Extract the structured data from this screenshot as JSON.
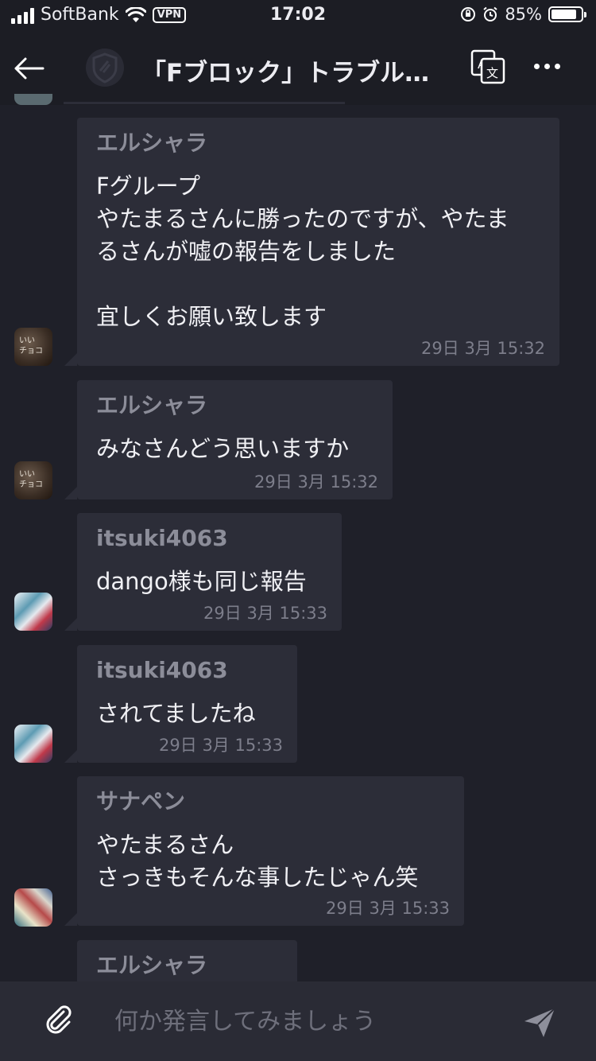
{
  "status_bar": {
    "carrier": "SoftBank",
    "vpn": "VPN",
    "time": "17:02",
    "battery_percent": "85%",
    "battery_level": 0.85
  },
  "header": {
    "title": "「Fブロック」トラブル…",
    "icons": [
      "arrow-left-icon",
      "shield-icon",
      "translate-icon",
      "more-icon"
    ]
  },
  "messages": [
    {
      "sender": "エルシャラ",
      "text": "Fグループ\nやたまるさんに勝ったのですが、やたま\nるさんが嘘の報告をしました\n\n宜しくお願い致します",
      "time": "29日 3月 15:32"
    },
    {
      "sender": "エルシャラ",
      "text": "みなさんどう思いますか",
      "time": "29日 3月 15:32"
    },
    {
      "sender": "itsuki4063",
      "text": "dango様も同じ報告",
      "time": "29日 3月 15:33"
    },
    {
      "sender": "itsuki4063",
      "text": "されてましたね",
      "time": "29日 3月 15:33"
    },
    {
      "sender": "サナペン",
      "text": "やたまるさん\nさっきもそんな事したじゃん笑",
      "time": "29日 3月 15:33"
    },
    {
      "sender": "エルシャラ",
      "text": "",
      "time": ""
    }
  ],
  "avatar_texts": {
    "elshara": "いい\nチョコ"
  },
  "composer": {
    "placeholder": "何か発言してみましょう",
    "icons": [
      "paperclip-icon",
      "send-icon"
    ]
  }
}
